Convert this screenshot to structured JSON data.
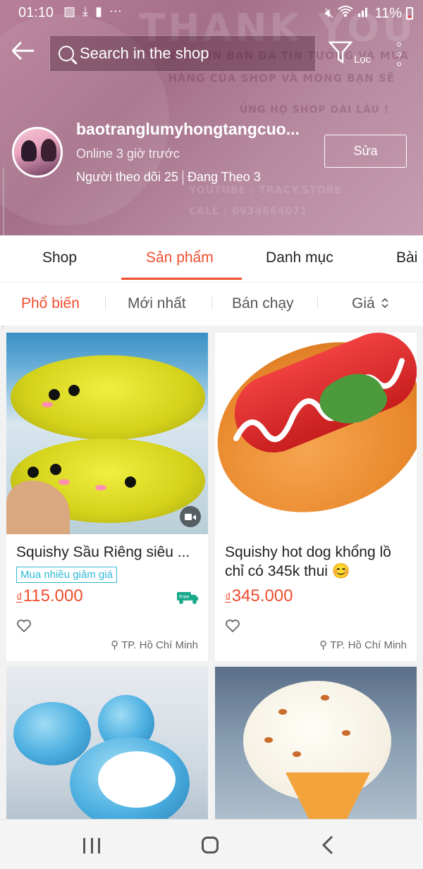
{
  "status_bar": {
    "time": "01:10",
    "battery": "11%"
  },
  "search": {
    "placeholder": "Search in the shop"
  },
  "filter": {
    "label": "Lọc"
  },
  "shop": {
    "name": "baotranglumyhongtangcuo...",
    "online": "Online 3 giờ trước",
    "followers": "Người theo dõi 25",
    "following": "Đang Theo 3",
    "edit_label": "Sửa"
  },
  "tabs": [
    {
      "label": "Shop"
    },
    {
      "label": "Sản phẩm"
    },
    {
      "label": "Danh mục"
    },
    {
      "label": "Bài"
    }
  ],
  "sort": [
    {
      "label": "Phổ biến"
    },
    {
      "label": "Mới nhất"
    },
    {
      "label": "Bán chạy"
    },
    {
      "label": "Giá"
    }
  ],
  "products": [
    {
      "title": "Squishy Sầu Riêng siêu ...",
      "badge": "Mua nhiều giảm giá",
      "currency": "₫",
      "price": "115.000",
      "location": "TP. Hồ Chí Minh",
      "freeship": "Free"
    },
    {
      "title": "Squishy hot dog khổng lồ chỉ có 345k thui 😊",
      "currency": "₫",
      "price": "345.000",
      "location": "TP. Hồ Chí Minh"
    }
  ],
  "colors": {
    "accent": "#ee4d2d",
    "badge": "#2fb8d6",
    "header_bg": "#b07b95"
  }
}
